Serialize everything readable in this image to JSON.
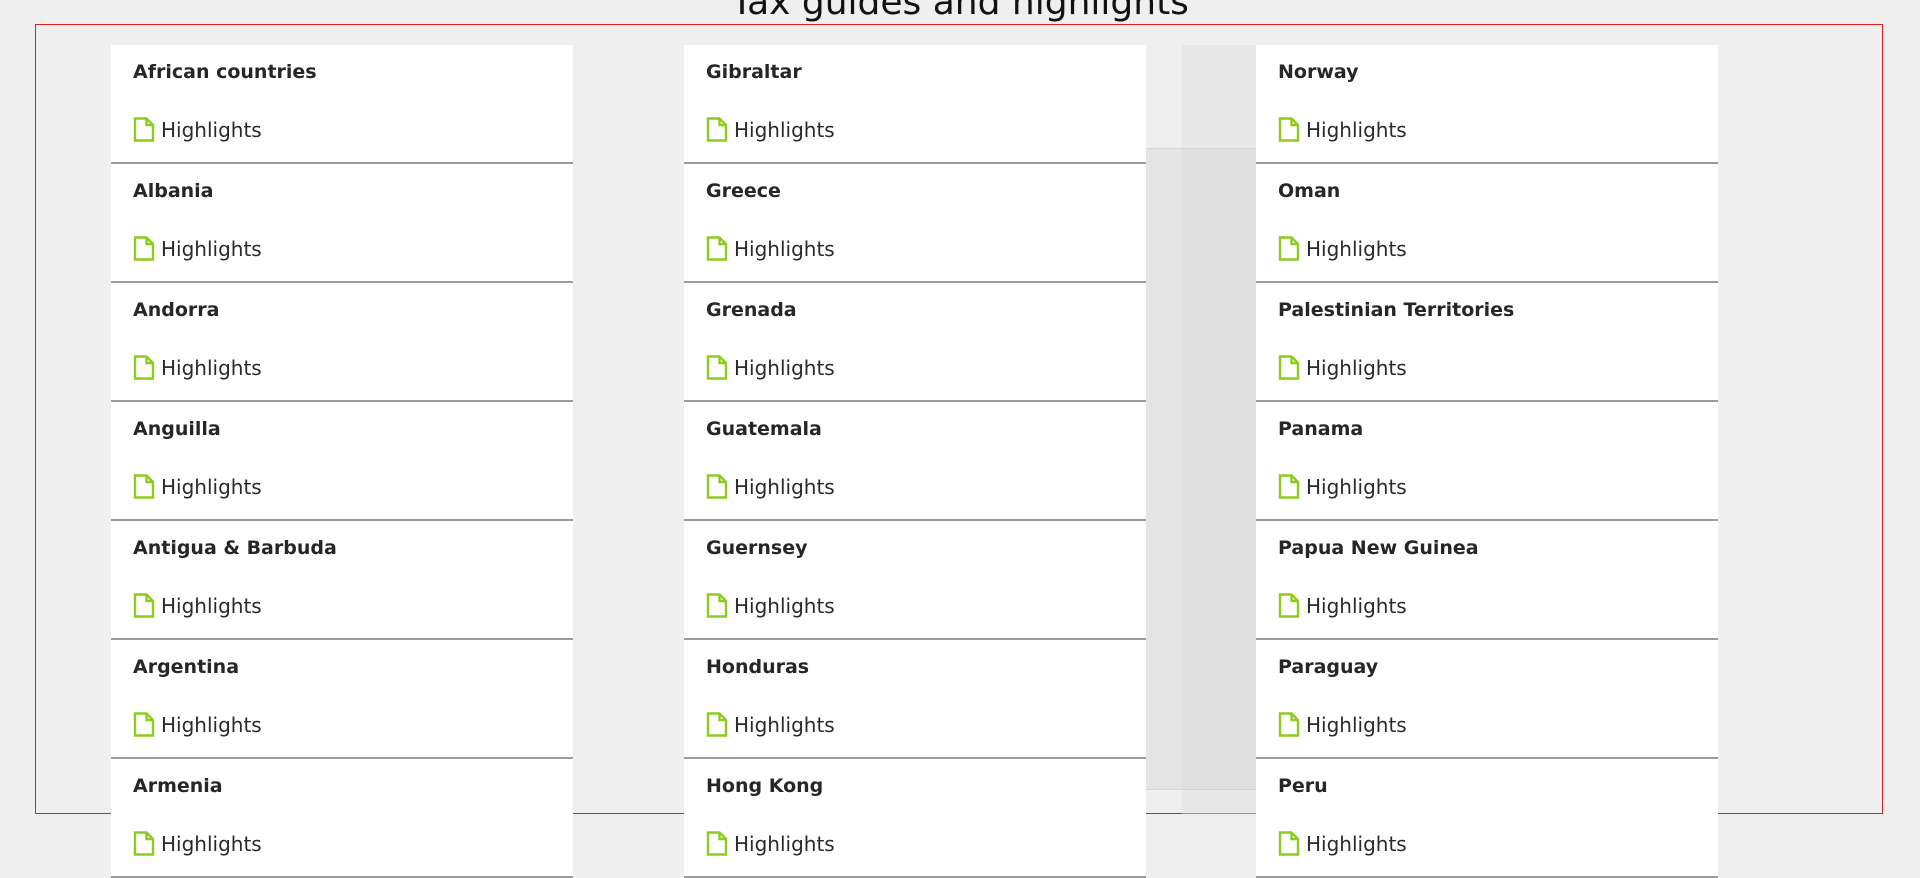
{
  "page": {
    "title": "Tax guides and highlights",
    "link_label": "Highlights",
    "accent_color": "#8ccc1f",
    "frame_color": "#e02020"
  },
  "columns": [
    {
      "items": [
        {
          "title": "African countries"
        },
        {
          "title": "Albania"
        },
        {
          "title": "Andorra"
        },
        {
          "title": "Anguilla"
        },
        {
          "title": "Antigua & Barbuda"
        },
        {
          "title": "Argentina"
        },
        {
          "title": "Armenia"
        }
      ]
    },
    {
      "items": [
        {
          "title": "Gibraltar"
        },
        {
          "title": "Greece"
        },
        {
          "title": "Grenada"
        },
        {
          "title": "Guatemala"
        },
        {
          "title": "Guernsey"
        },
        {
          "title": "Honduras"
        },
        {
          "title": "Hong Kong"
        }
      ]
    },
    {
      "items": [
        {
          "title": "Norway"
        },
        {
          "title": "Oman"
        },
        {
          "title": "Palestinian Territories"
        },
        {
          "title": "Panama"
        },
        {
          "title": "Papua New Guinea"
        },
        {
          "title": "Paraguay"
        },
        {
          "title": "Peru"
        }
      ]
    }
  ]
}
